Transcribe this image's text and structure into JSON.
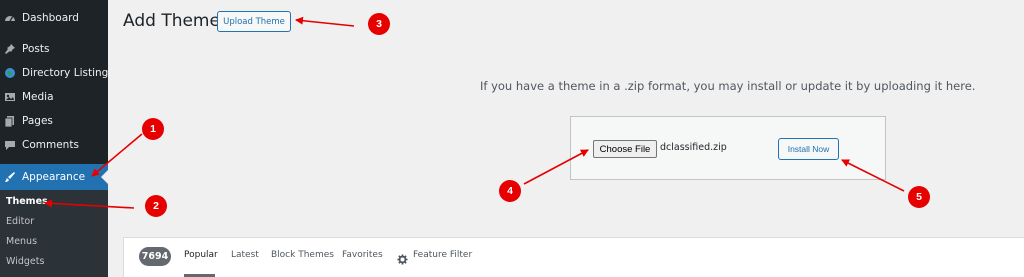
{
  "sidebar": {
    "items": [
      {
        "label": "Dashboard",
        "icon": "dashboard-icon"
      },
      {
        "label": "Posts",
        "icon": "pin-icon"
      },
      {
        "label": "Directory Listings",
        "icon": "globe-icon"
      },
      {
        "label": "Media",
        "icon": "media-icon"
      },
      {
        "label": "Pages",
        "icon": "pages-icon"
      },
      {
        "label": "Comments",
        "icon": "comment-icon"
      },
      {
        "label": "Appearance",
        "icon": "brush-icon"
      }
    ],
    "submenu": [
      "Themes",
      "Editor",
      "Menus",
      "Widgets"
    ]
  },
  "header": {
    "title": "Add Themes",
    "upload_label": "Upload Theme"
  },
  "upload": {
    "help_text": "If you have a theme in a .zip format, you may install or update it by uploading it here.",
    "choose_label": "Choose File",
    "file_name": "dclassified.zip",
    "install_label": "Install Now"
  },
  "filter": {
    "count": "7694",
    "tabs": [
      "Popular",
      "Latest",
      "Block Themes",
      "Favorites"
    ],
    "feature_filter": "Feature Filter"
  },
  "annotations": [
    "1",
    "2",
    "3",
    "4",
    "5"
  ],
  "colors": {
    "sidebar_bg": "#1d2327",
    "active_bg": "#2271b1",
    "annotation_red": "#e60000"
  }
}
